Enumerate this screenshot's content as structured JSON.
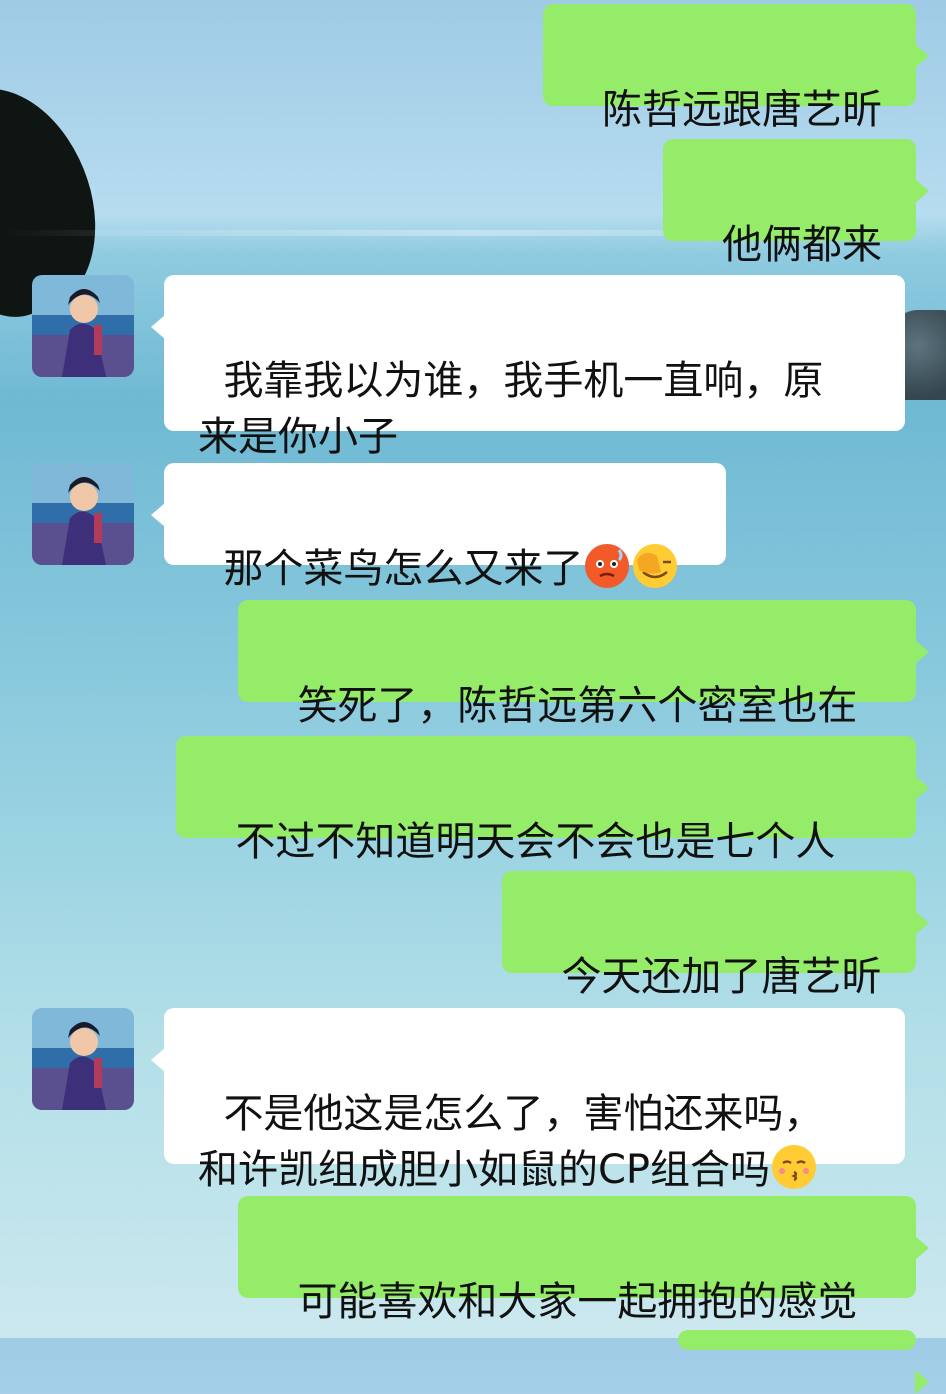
{
  "messages": [
    {
      "side": "out",
      "text": "陈哲远跟唐艺昕"
    },
    {
      "side": "out",
      "text": "他俩都来"
    },
    {
      "side": "in",
      "text": "我靠我以为谁，我手机一直响，原\n来是你小子"
    },
    {
      "side": "in",
      "text": "那个菜鸟怎么又来了",
      "emojis": [
        "overheated-face",
        "facepalm-face"
      ]
    },
    {
      "side": "out",
      "text": "笑死了，陈哲远第六个密室也在"
    },
    {
      "side": "out",
      "text": "不过不知道明天会不会也是七个人"
    },
    {
      "side": "out",
      "text": "今天还加了唐艺昕"
    },
    {
      "side": "in",
      "text": "不是他这是怎么了，害怕还来吗，\n和许凯组成胆小如鼠的CP组合吗",
      "emojis": [
        "kissing-face"
      ]
    },
    {
      "side": "out",
      "text": "可能喜欢和大家一起拥抱的感觉"
    }
  ],
  "colors": {
    "outgoing_bubble": "#95ec69",
    "incoming_bubble": "#ffffff",
    "text": "#111111"
  }
}
